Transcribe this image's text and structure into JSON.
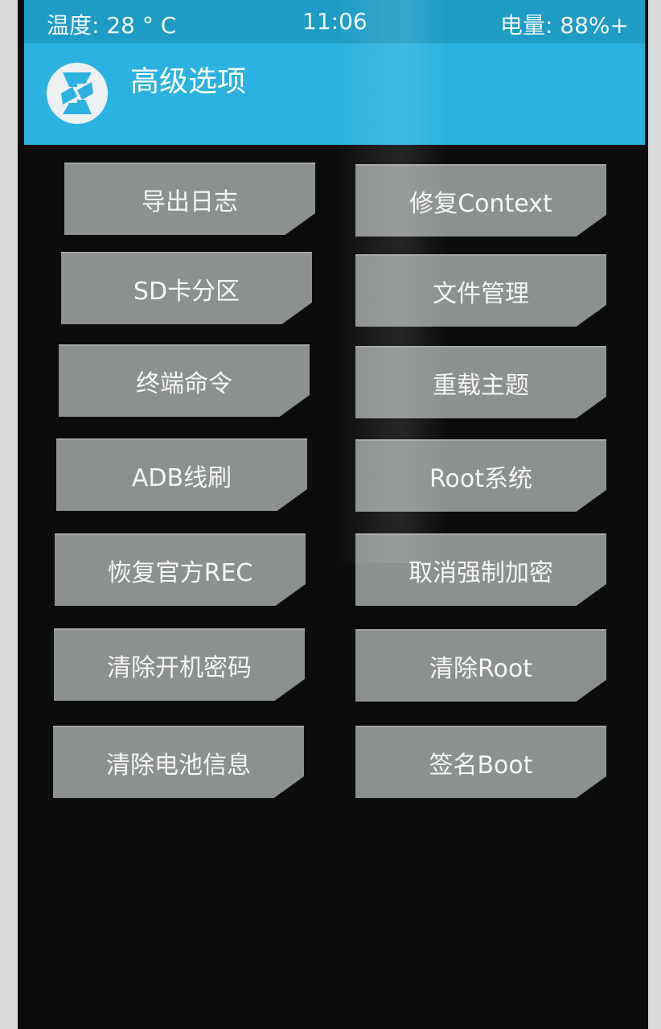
{
  "status_bar": {
    "temperature": "温度: 28 ° C",
    "time": "11:06",
    "battery": "电量: 88%+"
  },
  "header": {
    "title": "高级选项",
    "logo_icon": "twrp-logo-icon"
  },
  "menu": {
    "left": [
      "导出日志",
      "SD卡分区",
      "终端命令",
      "ADB线刷",
      "恢复官方REC",
      "清除开机密码",
      "清除电池信息"
    ],
    "right": [
      "修复Context",
      "文件管理",
      "重载主题",
      "Root系统",
      "取消强制加密",
      "清除Root",
      "签名Boot"
    ]
  },
  "colors": {
    "status_bar": "#1e9cc6",
    "header": "#2cb2e0",
    "button": "#8d918d",
    "background": "#0c0c0d"
  }
}
